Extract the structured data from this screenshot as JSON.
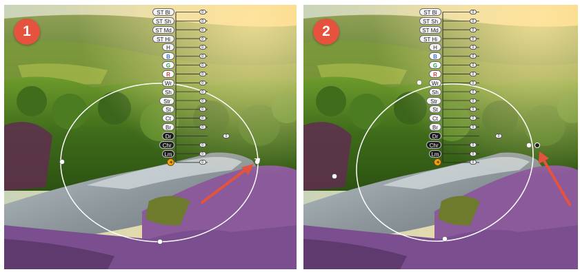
{
  "panels": [
    {
      "number": "1",
      "adjustments": [
        {
          "label": "ST Bl",
          "kind": "normal"
        },
        {
          "label": "ST Sh",
          "kind": "normal"
        },
        {
          "label": "ST Md",
          "kind": "normal"
        },
        {
          "label": "ST Hi",
          "kind": "normal"
        },
        {
          "label": "H",
          "kind": "normal"
        },
        {
          "label": "B",
          "kind": "hue",
          "color": "#2d6ed8"
        },
        {
          "label": "G",
          "kind": "hue",
          "color": "#2f9d3f"
        },
        {
          "label": "R",
          "kind": "hue",
          "color": "#d83a3a"
        },
        {
          "label": "Wr",
          "kind": "normal"
        },
        {
          "label": "Sh",
          "kind": "normal"
        },
        {
          "label": "Str",
          "kind": "normal"
        },
        {
          "label": "St",
          "kind": "normal"
        },
        {
          "label": "Ct",
          "kind": "normal"
        },
        {
          "label": "Br",
          "kind": "normal"
        },
        {
          "label": "Dr",
          "kind": "dark"
        },
        {
          "label": "Chr",
          "kind": "dark"
        },
        {
          "label": "Lm",
          "kind": "dark"
        },
        {
          "label": "sun",
          "kind": "sun"
        }
      ],
      "values": [
        "0",
        "0",
        "0",
        "0",
        "0",
        "0",
        "0",
        "0",
        "0",
        "0",
        "0",
        "0",
        "0",
        "0",
        "0",
        "0",
        "0",
        "0"
      ],
      "slider_fill": [
        0.1,
        0.1,
        0.1,
        0.1,
        0.1,
        0.1,
        0.1,
        0.1,
        0.1,
        0.1,
        0.1,
        0.1,
        0.1,
        0.1,
        0.5,
        0.1,
        0.1,
        0.1
      ]
    },
    {
      "number": "2",
      "adjustments": [
        {
          "label": "ST Bl",
          "kind": "normal"
        },
        {
          "label": "ST Sh",
          "kind": "normal"
        },
        {
          "label": "ST Md",
          "kind": "normal"
        },
        {
          "label": "ST Hi",
          "kind": "normal"
        },
        {
          "label": "H",
          "kind": "normal"
        },
        {
          "label": "B",
          "kind": "hue",
          "color": "#2d6ed8"
        },
        {
          "label": "G",
          "kind": "hue",
          "color": "#2f9d3f"
        },
        {
          "label": "R",
          "kind": "hue",
          "color": "#d83a3a"
        },
        {
          "label": "Wr",
          "kind": "normal"
        },
        {
          "label": "Sh",
          "kind": "normal"
        },
        {
          "label": "Str",
          "kind": "normal"
        },
        {
          "label": "St",
          "kind": "normal"
        },
        {
          "label": "Ct",
          "kind": "normal"
        },
        {
          "label": "Br",
          "kind": "normal"
        },
        {
          "label": "Dr",
          "kind": "dark"
        },
        {
          "label": "Chr",
          "kind": "dark"
        },
        {
          "label": "Lm",
          "kind": "dark"
        },
        {
          "label": "sun",
          "kind": "sun"
        }
      ],
      "values": [
        "0",
        "0",
        "0",
        "0",
        "0",
        "0",
        "0",
        "0",
        "0",
        "0",
        "0",
        "0",
        "0",
        "0",
        "0",
        "0",
        "0",
        "0"
      ],
      "slider_fill": [
        0.15,
        0.15,
        0.15,
        0.15,
        0.15,
        0.15,
        0.15,
        0.15,
        0.15,
        0.15,
        0.15,
        0.15,
        0.15,
        0.15,
        0.55,
        0.15,
        0.15,
        0.15
      ]
    }
  ],
  "colors": {
    "badge": "#e5533f",
    "arrow": "#e5533f",
    "ellipse_stroke": "#ffffff"
  },
  "icons": {
    "drag_cursor": "hand-cursor-icon",
    "arrow": "red-arrow-icon"
  }
}
